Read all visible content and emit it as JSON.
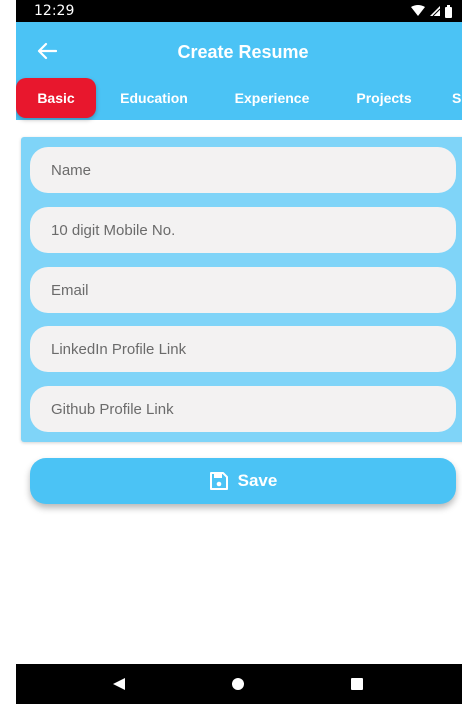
{
  "status_bar": {
    "time": "12:29",
    "icons": [
      "wifi-icon",
      "cell-signal-icon",
      "battery-icon"
    ]
  },
  "app_bar": {
    "title": "Create Resume",
    "back_icon": "arrow-left-icon",
    "background": "#4bc3f5"
  },
  "tabs": [
    {
      "label": "Basic",
      "active": true
    },
    {
      "label": "Education",
      "active": false
    },
    {
      "label": "Experience",
      "active": false
    },
    {
      "label": "Projects",
      "active": false
    },
    {
      "label": "S",
      "active": false
    }
  ],
  "form": {
    "fields": [
      {
        "placeholder": "Name",
        "value": ""
      },
      {
        "placeholder": "10 digit Mobile No.",
        "value": ""
      },
      {
        "placeholder": "Email",
        "value": ""
      },
      {
        "placeholder": "LinkedIn Profile Link",
        "value": ""
      },
      {
        "placeholder": "Github Profile Link",
        "value": ""
      }
    ]
  },
  "save_button": {
    "label": "Save",
    "icon": "floppy-disk-icon"
  },
  "nav_bar": {
    "icons": [
      "back-triangle-icon",
      "home-circle-icon",
      "recents-square-icon"
    ]
  },
  "colors": {
    "accent": "#4bc3f5",
    "active_tab": "#e8172d",
    "card": "#7fd4f8",
    "field": "#f3f2f2"
  }
}
